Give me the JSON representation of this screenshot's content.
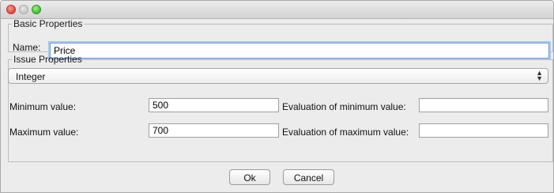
{
  "window": {
    "controls": [
      "close-icon",
      "minimize-icon",
      "zoom-icon"
    ],
    "colors": {
      "close": "#e0443b",
      "minimize": "#c8c8c8",
      "zoom": "#3ebc36"
    }
  },
  "basic_properties": {
    "legend": "Basic Properties",
    "name_label": "Name:",
    "name_value": "Price"
  },
  "issue_properties": {
    "legend": "Issue Properties",
    "type_selected": "Integer",
    "min_label": "Minimum value:",
    "min_value": "500",
    "min_eval_label": "Evaluation of minimum value:",
    "min_eval_value": "",
    "max_label": "Maximum value:",
    "max_value": "700",
    "max_eval_label": "Evaluation of maximum value:",
    "max_eval_value": ""
  },
  "buttons": {
    "ok": "Ok",
    "cancel": "Cancel"
  }
}
